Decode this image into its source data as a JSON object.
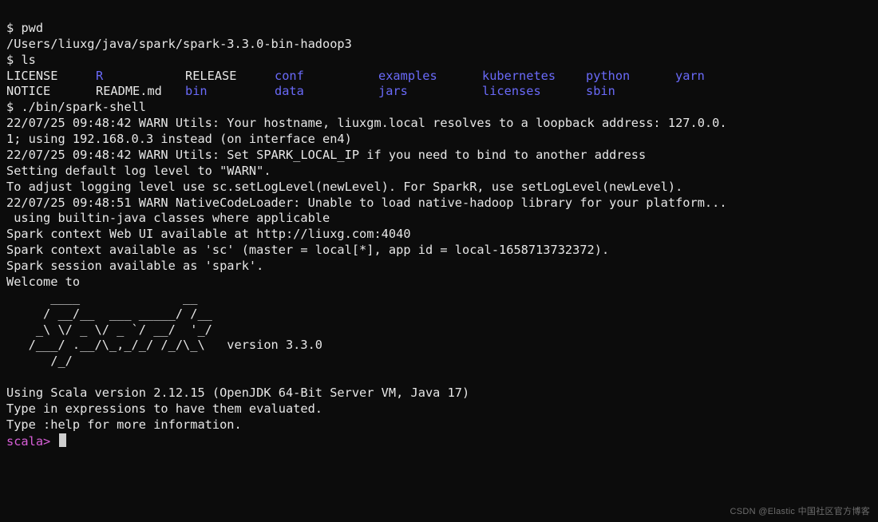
{
  "prompt": "$",
  "commands": {
    "pwd": "pwd",
    "ls": "ls",
    "sparkshell": "./bin/spark-shell"
  },
  "pwd_output": "/Users/liuxg/java/spark/spark-3.3.0-bin-hadoop3",
  "ls_rows": [
    [
      {
        "t": "LICENSE",
        "c": "file"
      },
      {
        "t": "R",
        "c": "dir"
      },
      {
        "t": "RELEASE",
        "c": "file"
      },
      {
        "t": "conf",
        "c": "dir"
      },
      {
        "t": "examples",
        "c": "dir"
      },
      {
        "t": "kubernetes",
        "c": "dir"
      },
      {
        "t": "python",
        "c": "dir"
      },
      {
        "t": "yarn",
        "c": "dir"
      }
    ],
    [
      {
        "t": "NOTICE",
        "c": "file"
      },
      {
        "t": "README.md",
        "c": "file"
      },
      {
        "t": "bin",
        "c": "dir"
      },
      {
        "t": "data",
        "c": "dir"
      },
      {
        "t": "jars",
        "c": "dir"
      },
      {
        "t": "licenses",
        "c": "dir"
      },
      {
        "t": "sbin",
        "c": "dir"
      },
      {
        "t": "",
        "c": "file"
      }
    ]
  ],
  "spark_output": [
    "22/07/25 09:48:42 WARN Utils: Your hostname, liuxgm.local resolves to a loopback address: 127.0.0.",
    "1; using 192.168.0.3 instead (on interface en4)",
    "22/07/25 09:48:42 WARN Utils: Set SPARK_LOCAL_IP if you need to bind to another address",
    "Setting default log level to \"WARN\".",
    "To adjust logging level use sc.setLogLevel(newLevel). For SparkR, use setLogLevel(newLevel).",
    "22/07/25 09:48:51 WARN NativeCodeLoader: Unable to load native-hadoop library for your platform...",
    " using builtin-java classes where applicable",
    "Spark context Web UI available at http://liuxg.com:4040",
    "Spark context available as 'sc' (master = local[*], app id = local-1658713732372).",
    "Spark session available as 'spark'.",
    "Welcome to"
  ],
  "ascii_art": [
    "      ____              __",
    "     / __/__  ___ _____/ /__",
    "    _\\ \\/ _ \\/ _ `/ __/  '_/",
    "   /___/ .__/\\_,_/_/ /_/\\_\\   version 3.3.0",
    "      /_/"
  ],
  "footer_lines": [
    "",
    "Using Scala version 2.12.15 (OpenJDK 64-Bit Server VM, Java 17)",
    "Type in expressions to have them evaluated.",
    "Type :help for more information.",
    ""
  ],
  "scala_prompt": "scala>",
  "watermark": "CSDN @Elastic 中国社区官方博客"
}
